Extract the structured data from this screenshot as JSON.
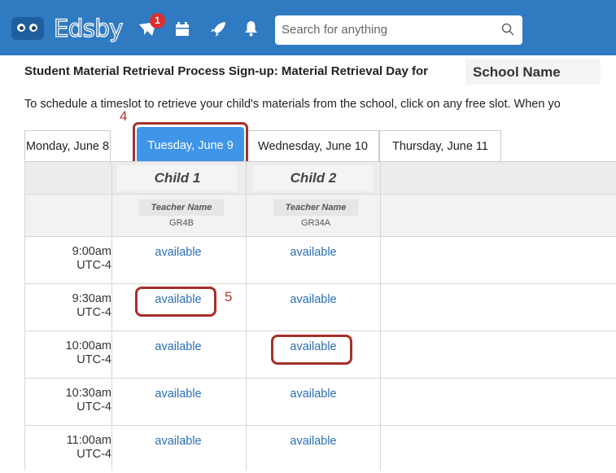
{
  "app": {
    "logo": "Edsby"
  },
  "nav": {
    "notification_count": "1",
    "search_placeholder": "Search for anything"
  },
  "page": {
    "title": "Student Material Retrieval Process Sign-up: Material Retrieval Day for",
    "school": "School Name",
    "instructions": "To schedule a timeslot to retrieve your child's materials from the school, click on any free slot. When yo",
    "step4": "4",
    "step5": "5"
  },
  "tabs": [
    "Monday, June 8",
    "Tuesday, June 9",
    "Wednesday, June 10",
    "Thursday, June 11"
  ],
  "children": [
    {
      "name": "Child 1",
      "teacher": "Teacher Name",
      "room": "GR4B"
    },
    {
      "name": "Child 2",
      "teacher": "Teacher Name",
      "room": "GR34A"
    }
  ],
  "slots": [
    {
      "time": "9:00am",
      "tz": "UTC-4",
      "c1": "available",
      "c2": "available"
    },
    {
      "time": "9:30am",
      "tz": "UTC-4",
      "c1": "available",
      "c2": "available"
    },
    {
      "time": "10:00am",
      "tz": "UTC-4",
      "c1": "available",
      "c2": "available"
    },
    {
      "time": "10:30am",
      "tz": "UTC-4",
      "c1": "available",
      "c2": "available"
    },
    {
      "time": "11:00am",
      "tz": "UTC-4",
      "c1": "available",
      "c2": "available"
    }
  ],
  "colors": {
    "brand": "#2f7ac0",
    "active_tab": "#3f95e8",
    "annotation": "#a5302a",
    "link": "#2a6fb5"
  }
}
